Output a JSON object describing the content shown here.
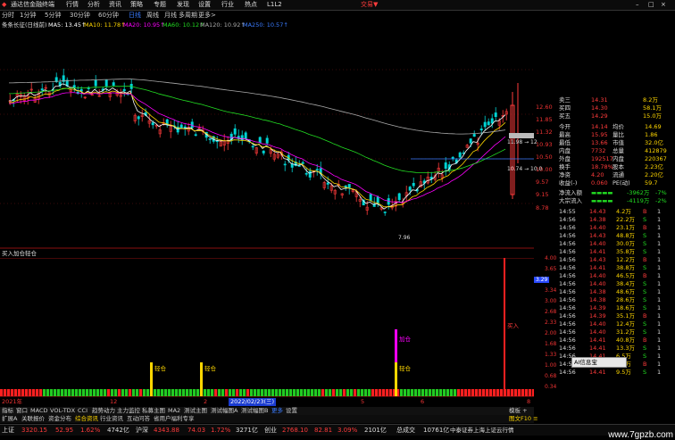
{
  "window": {
    "app_title": "通达信金融终端",
    "menu": [
      "行情",
      "分析",
      "资讯",
      "策略",
      "专题",
      "发现",
      "设置",
      "行业",
      "热点",
      "L1L2"
    ],
    "brand": "交易▼",
    "window_controls": [
      "–",
      "□",
      "×"
    ]
  },
  "toolbar": {
    "periods": [
      "1分钟",
      "5分钟",
      "30分钟",
      "60分钟",
      "日线",
      "周线",
      "月线",
      "多周期",
      "更多>"
    ],
    "first": "分时",
    "active_period": "日线"
  },
  "ma_legend": {
    "stock": "条条长征(日线前)",
    "items": [
      {
        "label": "MA5: 13.45↑",
        "color": "#ffffff"
      },
      {
        "label": "MA10: 11.78↑",
        "color": "#ffd700"
      },
      {
        "label": "MA20: 10.95↑",
        "color": "#ff00ff"
      },
      {
        "label": "MA60: 10.12↑",
        "color": "#22dd22"
      },
      {
        "label": "MA120: 10.92↑",
        "color": "#aaaaaa"
      },
      {
        "label": "MA250: 10.57↑",
        "color": "#3a7bff"
      }
    ]
  },
  "price_axis": {
    "ticks": [
      "12.60",
      "11.85",
      "11.32",
      "10.93",
      "10.50",
      "10.00",
      "9.57",
      "9.15",
      "8.78"
    ],
    "low_label": "7.96",
    "mid_label": "11.98 → 12",
    "alt_label": "10.74 → 10.0"
  },
  "sub_title": {
    "name": "买入加仓轻仓",
    "color": "#dddddd"
  },
  "sub_axis": {
    "ticks": [
      "4.00",
      "3.65",
      "3.34",
      "3.00",
      "2.68",
      "2.33",
      "2.00",
      "1.68",
      "1.33",
      "1.00",
      "0.68",
      "0.34"
    ],
    "badge": "3.29"
  },
  "sub_signals": [
    {
      "label": "轻仓",
      "color": "#ffd700"
    },
    {
      "label": "轻仓",
      "color": "#ffd700"
    },
    {
      "label": "加仓",
      "color": "#ff00ff"
    },
    {
      "label": "轻仓",
      "color": "#ffd700"
    },
    {
      "label": "买入",
      "color": "#ff3b3b"
    }
  ],
  "date_axis": {
    "labels": [
      "2021年",
      "12",
      "2",
      "2022/02/23(三)",
      "5",
      "6",
      "8"
    ],
    "highlight": "2022/02/23(三)"
  },
  "tabs1": {
    "items": [
      "指标",
      "窗口",
      "MACD",
      "VOL-TDX",
      "CCI",
      "趋势动力",
      "主力监控",
      "私募主图",
      "MA2",
      "测试主图",
      "测试幅图A",
      "测试幅图B",
      "更多",
      "设置"
    ],
    "right": "模板 +"
  },
  "tabs2": {
    "items": [
      "扩展A",
      "关联报价",
      "资金分布",
      "综合资讯",
      "行业资讯",
      "互动问答",
      "省用户福利专享"
    ],
    "right": "图文F10 ≡"
  },
  "quote": {
    "asks": [
      {
        "label": "卖三",
        "price": "14.31",
        "vol": "8.2万"
      },
      {
        "label": "买四",
        "price": "14.30",
        "vol": "58.1万"
      },
      {
        "label": "买五",
        "price": "14.29",
        "vol": "15.0万"
      }
    ],
    "stats": [
      {
        "l1": "今开",
        "v1": "14.14",
        "l2": "均价",
        "v2": "14.69"
      },
      {
        "l1": "最高",
        "v1": "15.95",
        "l2": "量比",
        "v2": "1.86"
      },
      {
        "l1": "最低",
        "v1": "13.66",
        "l2": "市值",
        "v2": "32.0亿"
      },
      {
        "l1": "内盘",
        "v1": "7732",
        "l2": "总量",
        "v2": "412879"
      },
      {
        "l1": "外盘",
        "v1": "192517",
        "l2": "内盘",
        "v2": "220367"
      },
      {
        "l1": "换手",
        "v1": "18.78%",
        "l2": "股本",
        "v2": "2.23亿"
      },
      {
        "l1": "净资",
        "v1": "4.20",
        "l2": "流通",
        "v2": "2.20亿"
      },
      {
        "l1": "收益(-)",
        "v1": "0.060",
        "l2": "PE(动)",
        "v2": "59.7"
      }
    ],
    "flows": [
      {
        "label": "净流入额",
        "value": "-3962万",
        "pct": "-7%"
      },
      {
        "label": "大宗流入",
        "value": "-4119万",
        "pct": "-2%"
      }
    ]
  },
  "ticks": [
    {
      "t": "14:55",
      "p": "14.43",
      "v": "4.2万",
      "s": "B"
    },
    {
      "t": "14:56",
      "p": "14.38",
      "v": "22.2万",
      "s": "S"
    },
    {
      "t": "14:56",
      "p": "14.40",
      "v": "23.1万",
      "s": "B"
    },
    {
      "t": "14:56",
      "p": "14.43",
      "v": "48.8万",
      "s": "S"
    },
    {
      "t": "14:56",
      "p": "14.40",
      "v": "30.0万",
      "s": "S"
    },
    {
      "t": "14:56",
      "p": "14.41",
      "v": "35.8万",
      "s": "S"
    },
    {
      "t": "14:56",
      "p": "14.43",
      "v": "12.2万",
      "s": "B"
    },
    {
      "t": "14:56",
      "p": "14.41",
      "v": "38.8万",
      "s": "S"
    },
    {
      "t": "14:56",
      "p": "14.40",
      "v": "46.5万",
      "s": "B"
    },
    {
      "t": "14:56",
      "p": "14.40",
      "v": "38.4万",
      "s": "S"
    },
    {
      "t": "14:56",
      "p": "14.38",
      "v": "48.6万",
      "s": "S"
    },
    {
      "t": "14:56",
      "p": "14.38",
      "v": "28.6万",
      "s": "S"
    },
    {
      "t": "14:56",
      "p": "14.39",
      "v": "18.6万",
      "s": "S"
    },
    {
      "t": "14:56",
      "p": "14.39",
      "v": "35.1万",
      "s": "B"
    },
    {
      "t": "14:56",
      "p": "14.40",
      "v": "12.4万",
      "s": "S"
    },
    {
      "t": "14:56",
      "p": "14.40",
      "v": "31.2万",
      "s": "S"
    },
    {
      "t": "14:56",
      "p": "14.41",
      "v": "40.8万",
      "s": "B"
    },
    {
      "t": "14:56",
      "p": "14.41",
      "v": "13.3万",
      "s": "S"
    },
    {
      "t": "14:56",
      "p": "14.41",
      "v": "6.5万",
      "s": "S"
    },
    {
      "t": "14:56",
      "p": "14.41",
      "v": "8.0万",
      "s": "B"
    },
    {
      "t": "14:56",
      "p": "14.41",
      "v": "9.5万",
      "s": "S"
    }
  ],
  "tooltip": "AI信息宝",
  "status": {
    "items": [
      {
        "label": "上证",
        "value": "3320.15",
        "chg": "52.95",
        "pct": "1.62%",
        "amt": "4742亿"
      },
      {
        "label": "沪深",
        "value": "4343.88",
        "chg": "74.03",
        "pct": "1.72%",
        "amt": "3271亿"
      },
      {
        "label": "创业",
        "value": "2768.10",
        "chg": "82.81",
        "pct": "3.09%",
        "amt": "2101亿"
      }
    ],
    "tail": "总成交",
    "tail_val": "10761亿",
    "broker": "中泰证券上海上证云行情"
  },
  "watermark": "www.7gpzb.com"
}
